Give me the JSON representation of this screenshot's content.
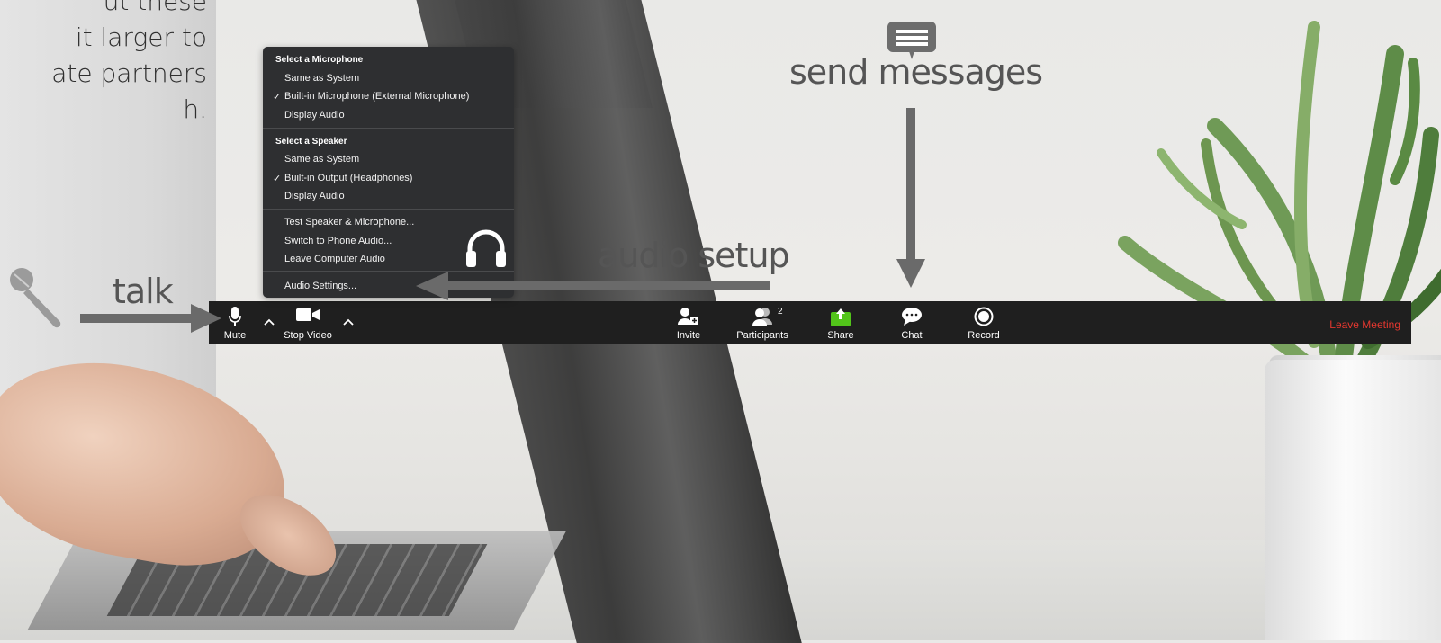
{
  "intro_text": "ut these\nit larger to\nate partners\nh.",
  "annotations": {
    "talk": "talk",
    "audio_setup": "audio setup",
    "send_messages": "send messages"
  },
  "audio_menu": {
    "mic_header": "Select a Microphone",
    "mic_items": [
      "Same as System",
      "Built-in Microphone (External Microphone)",
      "Display Audio"
    ],
    "mic_checked_index": 1,
    "speaker_header": "Select a Speaker",
    "speaker_items": [
      "Same as System",
      "Built-in Output (Headphones)",
      "Display Audio"
    ],
    "speaker_checked_index": 1,
    "actions": [
      "Test Speaker & Microphone...",
      "Switch to Phone Audio...",
      "Leave Computer Audio"
    ],
    "settings": "Audio Settings...",
    "check_glyph": "✓"
  },
  "toolbar": {
    "mute": "Mute",
    "stop_video": "Stop Video",
    "invite": "Invite",
    "participants": "Participants",
    "participants_count": "2",
    "share": "Share",
    "chat": "Chat",
    "record": "Record",
    "leave": "Leave Meeting"
  },
  "colors": {
    "toolbar_bg": "#1f1f1f",
    "menu_bg": "#2e2f31",
    "share_green": "#52c41a",
    "leave_red": "#e4372f",
    "annotation_gray": "#555555"
  },
  "icons": {
    "microphone_handheld": "microphone-icon",
    "headphones": "headphones-icon",
    "chat_bubble": "message-icon"
  }
}
